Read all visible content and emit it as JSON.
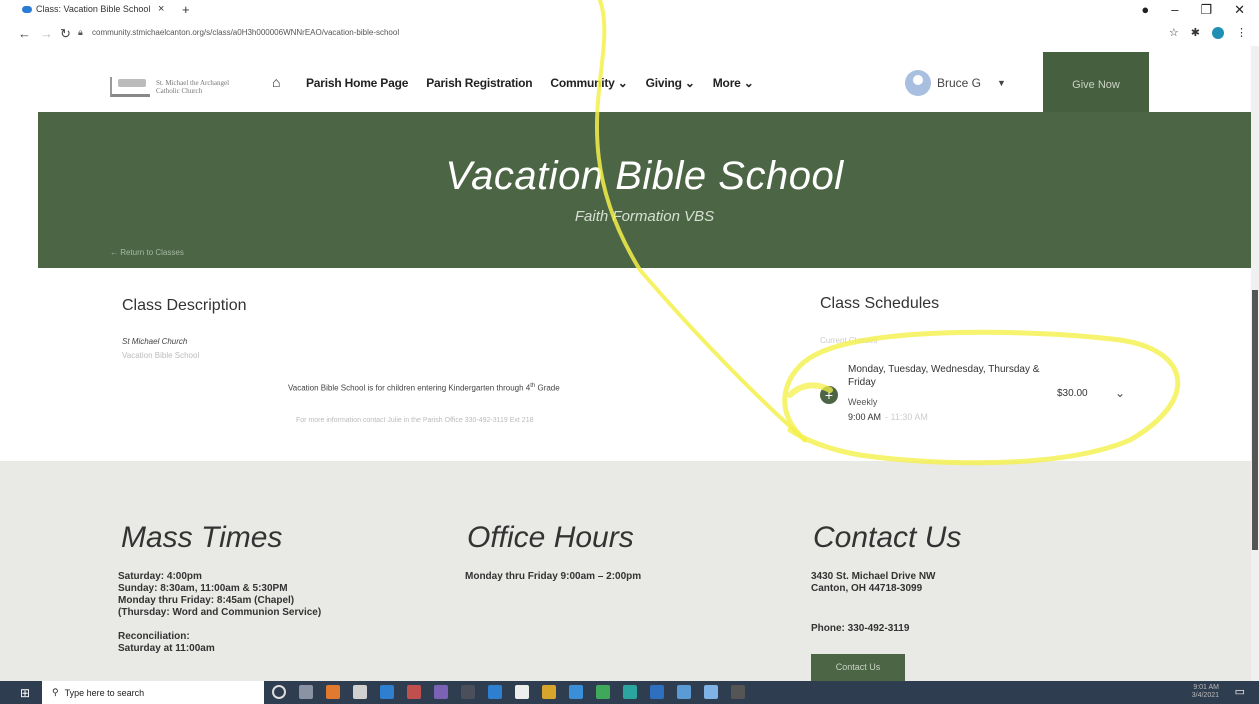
{
  "browser": {
    "tab_title": "Class: Vacation Bible School",
    "tab_close": "×",
    "new_tab": "+",
    "url": "community.stmichaelcanton.org/s/class/a0H3h000006WNNrEAO/vacation-bible-school",
    "user": "Bruce G"
  },
  "site": {
    "logo_line1": "St. Michael the Archangel",
    "logo_line2": "Catholic Church",
    "nav": [
      "Parish Home Page",
      "Parish Registration",
      "Community",
      "Giving",
      "More"
    ],
    "user_name": "Bruce G",
    "give_now": "Give Now"
  },
  "hero": {
    "title": "Vacation Bible School",
    "subtitle": "Faith Formation VBS",
    "return_link": "Return to Classes"
  },
  "class_description": {
    "heading": "Class Description",
    "church": "St Michael Church",
    "program": "Vacation Bible School",
    "body_prefix": "Vacation Bible School is for children entering  Kindergarten through 4",
    "body_sup": "th",
    "body_suffix": " Grade",
    "info": "For more information contact Julie in the Parish Office 330-492-3119 Ext 218"
  },
  "class_schedules": {
    "heading": "Class Schedules",
    "status": "Current Classes",
    "days": "Monday, Tuesday, Wednesday, Thursday & Friday",
    "frequency": "Weekly",
    "start_time": "9:00 AM",
    "end_time": "- 11:30 AM",
    "price": "$30.00"
  },
  "footer": {
    "mass_heading": "Mass Times",
    "mass_lines": [
      "Saturday: 4:00pm",
      "Sunday: 8:30am, 11:00am & 5:30PM",
      "Monday thru Friday: 8:45am (Chapel)",
      "(Thursday: Word and Communion Service)",
      "",
      "Reconciliation:",
      "Saturday at 11:00am"
    ],
    "office_heading": "Office Hours",
    "office_line": "Monday thru Friday 9:00am – 2:00pm",
    "contact_heading": "Contact Us",
    "address1": "3430 St. Michael Drive NW",
    "address2": "Canton, OH 44718-3099",
    "phone": "Phone: 330-492-3119",
    "contact_button": "Contact Us"
  },
  "taskbar": {
    "search_placeholder": "Type here to search",
    "time": "9:01 AM",
    "date": "3/4/2021"
  },
  "colors": {
    "brand_green": "#4b6545",
    "highlighter": "#f4f04a"
  }
}
